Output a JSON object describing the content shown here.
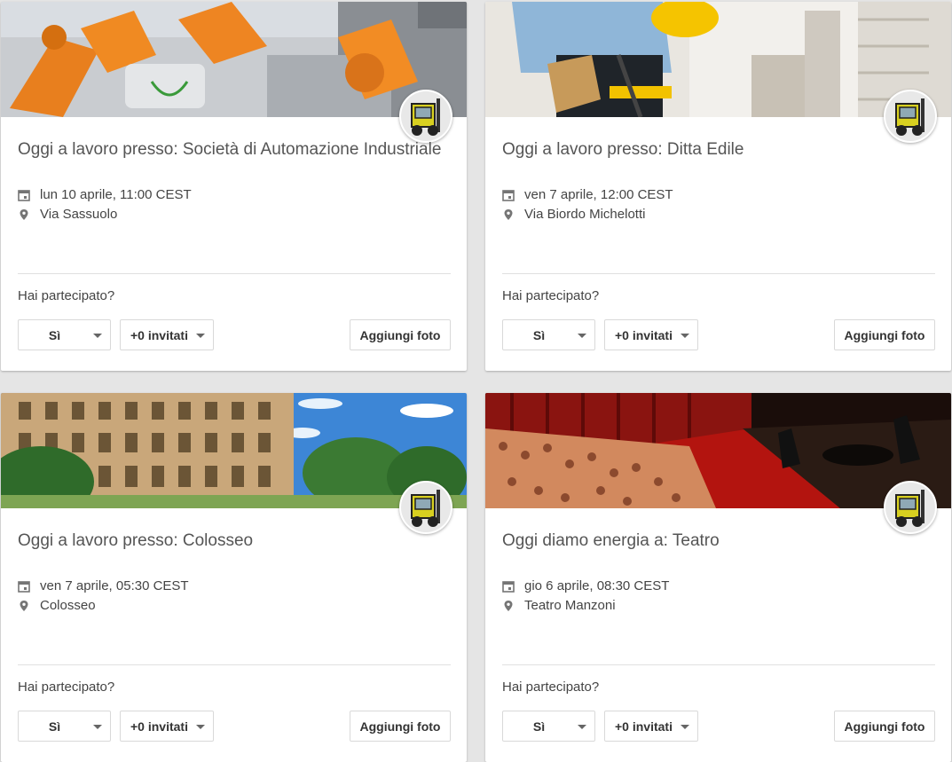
{
  "events": [
    {
      "title": "Oggi a lavoro presso: Società di Automazione Industriale",
      "date": "lun 10 aprile, 11:00 CEST",
      "location": "Via Sassuolo",
      "cover_icon": "robot-factory-image",
      "question": "Hai partecipato?",
      "rsvp": "Sì",
      "guests": "+0 invitati",
      "add_photo": "Aggiungi foto"
    },
    {
      "title": "Oggi a lavoro presso: Ditta Edile",
      "date": "ven 7 aprile, 12:00 CEST",
      "location": "Via Biordo Michelotti",
      "cover_icon": "construction-worker-image",
      "question": "Hai partecipato?",
      "rsvp": "Sì",
      "guests": "+0 invitati",
      "add_photo": "Aggiungi foto"
    },
    {
      "title": "Oggi a lavoro presso: Colosseo",
      "date": "ven 7 aprile, 05:30 CEST",
      "location": "Colosseo",
      "cover_icon": "colosseum-image",
      "question": "Hai partecipato?",
      "rsvp": "Sì",
      "guests": "+0 invitati",
      "add_photo": "Aggiungi foto"
    },
    {
      "title": "Oggi diamo energia a: Teatro",
      "date": "gio 6 aprile, 08:30 CEST",
      "location": "Teatro Manzoni",
      "cover_icon": "theater-image",
      "question": "Hai partecipato?",
      "rsvp": "Sì",
      "guests": "+0 invitati",
      "add_photo": "Aggiungi foto"
    }
  ],
  "avatar_icon": "forklift-icon",
  "colors": {
    "title_text": "#555555",
    "body_text": "#444444",
    "icon_gray": "#757575"
  }
}
